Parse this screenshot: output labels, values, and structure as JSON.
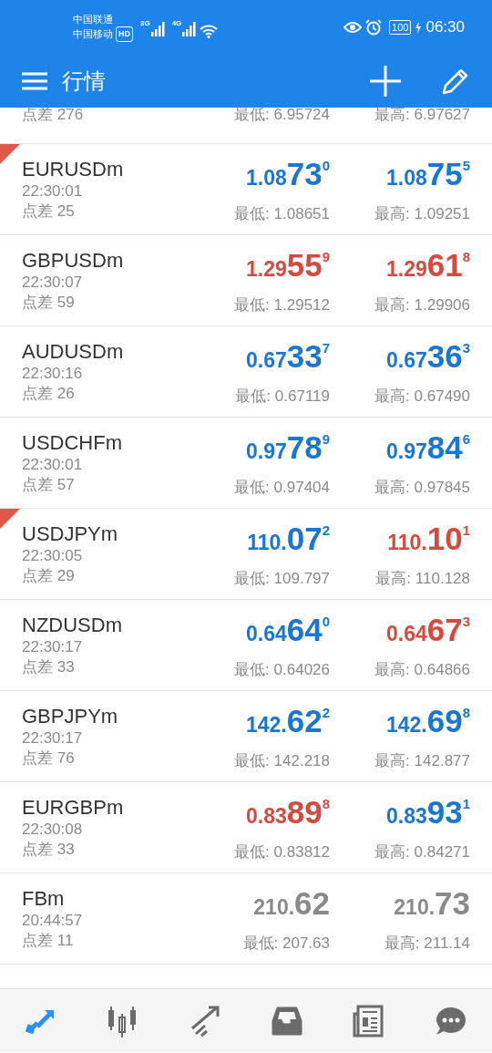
{
  "status_bar": {
    "carrier_1": "中国联通",
    "carrier_2": "中国移动",
    "hd": "HD",
    "net_1": "3G",
    "net_2": "4G",
    "battery": "100",
    "time": "06:30"
  },
  "app_bar": {
    "title": "行情"
  },
  "partial_row": {
    "spread": "点差 276",
    "low": "最低: 6.95724",
    "high": "最高: 6.97627"
  },
  "quotes": [
    {
      "symbol": "EURUSDm",
      "time": "22:30:01",
      "spread": "点差 25",
      "flagged": true,
      "bid": {
        "prefix": "1.08",
        "big": "73",
        "sup": "0",
        "color": "#1976d2"
      },
      "ask": {
        "prefix": "1.08",
        "big": "75",
        "sup": "5",
        "color": "#1976d2"
      },
      "low": "最低: 1.08651",
      "high": "最高: 1.09251"
    },
    {
      "symbol": "GBPUSDm",
      "time": "22:30:07",
      "spread": "点差 59",
      "flagged": false,
      "bid": {
        "prefix": "1.29",
        "big": "55",
        "sup": "9",
        "color": "#d54a3f"
      },
      "ask": {
        "prefix": "1.29",
        "big": "61",
        "sup": "8",
        "color": "#d54a3f"
      },
      "low": "最低: 1.29512",
      "high": "最高: 1.29906"
    },
    {
      "symbol": "AUDUSDm",
      "time": "22:30:16",
      "spread": "点差 26",
      "flagged": false,
      "bid": {
        "prefix": "0.67",
        "big": "33",
        "sup": "7",
        "color": "#1976d2"
      },
      "ask": {
        "prefix": "0.67",
        "big": "36",
        "sup": "3",
        "color": "#1976d2"
      },
      "low": "最低: 0.67119",
      "high": "最高: 0.67490"
    },
    {
      "symbol": "USDCHFm",
      "time": "22:30:01",
      "spread": "点差 57",
      "flagged": false,
      "bid": {
        "prefix": "0.97",
        "big": "78",
        "sup": "9",
        "color": "#1976d2"
      },
      "ask": {
        "prefix": "0.97",
        "big": "84",
        "sup": "6",
        "color": "#1976d2"
      },
      "low": "最低: 0.97404",
      "high": "最高: 0.97845"
    },
    {
      "symbol": "USDJPYm",
      "time": "22:30:05",
      "spread": "点差 29",
      "flagged": true,
      "bid": {
        "prefix": "110.",
        "big": "07",
        "sup": "2",
        "color": "#1976d2"
      },
      "ask": {
        "prefix": "110.",
        "big": "10",
        "sup": "1",
        "color": "#d54a3f"
      },
      "low": "最低: 109.797",
      "high": "最高: 110.128"
    },
    {
      "symbol": "NZDUSDm",
      "time": "22:30:17",
      "spread": "点差 33",
      "flagged": false,
      "bid": {
        "prefix": "0.64",
        "big": "64",
        "sup": "0",
        "color": "#1976d2"
      },
      "ask": {
        "prefix": "0.64",
        "big": "67",
        "sup": "3",
        "color": "#d54a3f"
      },
      "low": "最低: 0.64026",
      "high": "最高: 0.64866"
    },
    {
      "symbol": "GBPJPYm",
      "time": "22:30:17",
      "spread": "点差 76",
      "flagged": false,
      "bid": {
        "prefix": "142.",
        "big": "62",
        "sup": "2",
        "color": "#1976d2"
      },
      "ask": {
        "prefix": "142.",
        "big": "69",
        "sup": "8",
        "color": "#1976d2"
      },
      "low": "最低: 142.218",
      "high": "最高: 142.877"
    },
    {
      "symbol": "EURGBPm",
      "time": "22:30:08",
      "spread": "点差 33",
      "flagged": false,
      "bid": {
        "prefix": "0.83",
        "big": "89",
        "sup": "8",
        "color": "#d54a3f"
      },
      "ask": {
        "prefix": "0.83",
        "big": "93",
        "sup": "1",
        "color": "#1976d2"
      },
      "low": "最低: 0.83812",
      "high": "最高: 0.84271"
    },
    {
      "symbol": "FBm",
      "time": "20:44:57",
      "spread": "点差 11",
      "flagged": false,
      "bid": {
        "prefix": "210.",
        "big": "62",
        "color": "#8a8a8a"
      },
      "ask": {
        "prefix": "210.",
        "big": "73",
        "color": "#8a8a8a"
      },
      "low": "最低: 207.63",
      "high": "最高: 211.14"
    }
  ],
  "bottom_nav": [
    {
      "kind": "quotes",
      "selected": true
    },
    {
      "kind": "chart",
      "selected": false
    },
    {
      "kind": "trade",
      "selected": false
    },
    {
      "kind": "history",
      "selected": false
    },
    {
      "kind": "news",
      "selected": false
    },
    {
      "kind": "chat",
      "selected": false
    }
  ]
}
